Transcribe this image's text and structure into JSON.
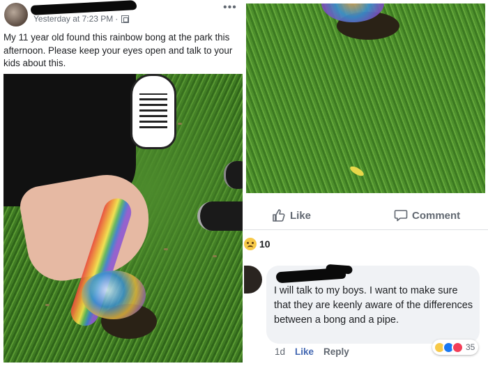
{
  "post": {
    "timestamp": "Yesterday at 7:23 PM",
    "separator": "·",
    "text": "My 11 year old found this rainbow bong at the park this afternoon. Please keep your eyes open and talk to your kids about this."
  },
  "actions": {
    "like_label": "Like",
    "comment_label": "Comment"
  },
  "reactions": {
    "count": "10",
    "icon": "sad-emoji"
  },
  "comment": {
    "text": "I will talk to my boys. I want to make sure that they are keenly aware of the differences between a bong and a pipe.",
    "time": "1d",
    "like_label": "Like",
    "reply_label": "Reply",
    "reaction_count": "35"
  },
  "icons": {
    "more": "more-dots-icon",
    "audience": "globe-icon",
    "like": "thumbs-up-icon",
    "comment": "speech-bubble-icon"
  },
  "colors": {
    "link_blue": "#4267b2",
    "muted_gray": "#606770",
    "bubble_bg": "#f0f2f5"
  }
}
